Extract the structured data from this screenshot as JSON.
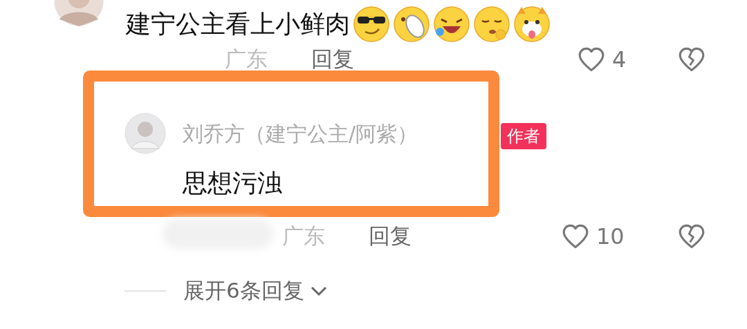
{
  "comment": {
    "text": "建宁公主看上小鲜肉",
    "location": "广东",
    "reply_label": "回复",
    "likes": "4"
  },
  "highlight": {
    "author": "刘乔方（建宁公主/阿紫）",
    "badge": "作者",
    "text": "思想污浊",
    "location": "广东",
    "reply_label": "回复",
    "likes": "10"
  },
  "expand": {
    "label": "展开6条回复"
  }
}
